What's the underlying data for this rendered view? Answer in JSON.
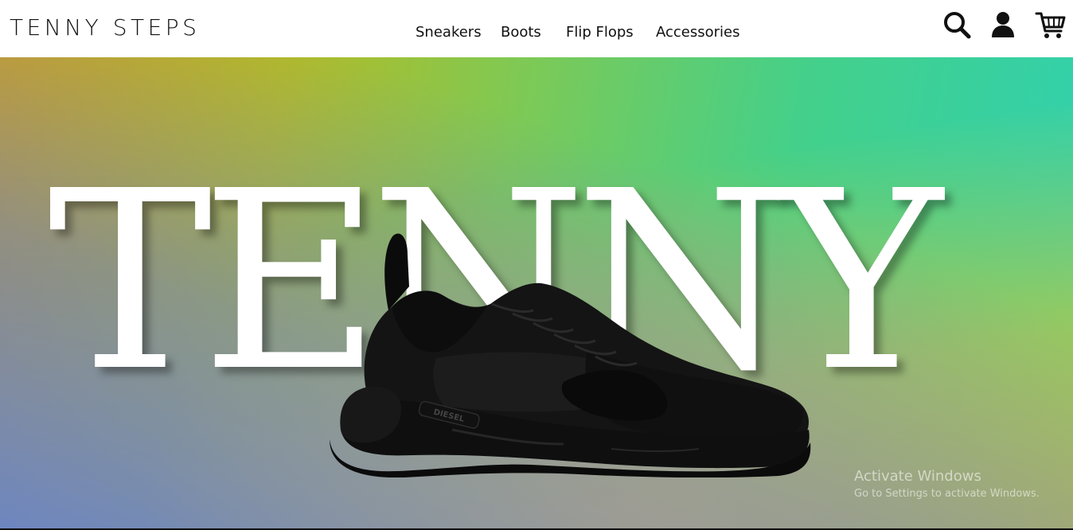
{
  "header": {
    "brand": "TENNY STEPS",
    "nav": [
      {
        "label": "Sneakers"
      },
      {
        "label": "Boots"
      },
      {
        "label": "Flip Flops"
      },
      {
        "label": "Accessories"
      }
    ],
    "icons": [
      "search-icon",
      "user-icon",
      "cart-icon"
    ]
  },
  "hero": {
    "headline": "TENNY",
    "shoe_logo": "DIESEL",
    "gradient_colors": [
      "#d6a512",
      "#7fc954",
      "#2fd1b1",
      "#5a7ddc",
      "#e8c31e"
    ]
  },
  "watermark": {
    "title": "Activate Windows",
    "subtitle": "Go to Settings to activate Windows."
  }
}
